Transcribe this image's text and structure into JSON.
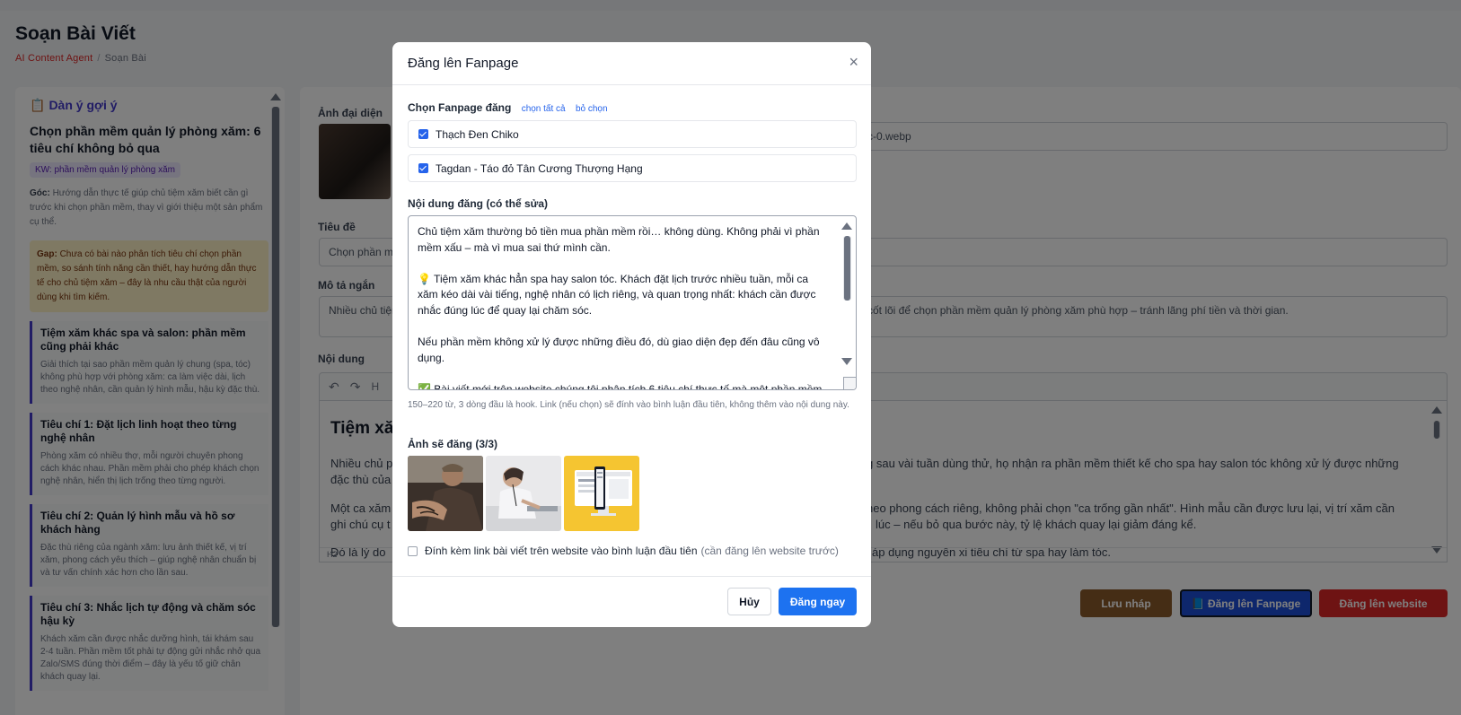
{
  "page": {
    "title": "Soạn Bài Viết",
    "breadcrumb": {
      "home": "AI Content Agent",
      "sep": "/",
      "current": "Soạn Bài"
    }
  },
  "outline": {
    "icon": "clipboard-icon",
    "heading": "Dàn ý gợi ý",
    "article_title": "Chọn phần mềm quản lý phòng xăm: 6 tiêu chí không bỏ qua",
    "keyword": "KW: phần mềm quản lý phòng xăm",
    "angle_label": "Góc:",
    "angle_text": "Hướng dẫn thực tế giúp chủ tiệm xăm biết cần gì trước khi chọn phần mềm, thay vì giới thiệu một sản phẩm cụ thể.",
    "gap_label": "Gap:",
    "gap_text": "Chưa có bài nào phân tích tiêu chí chọn phần mềm, so sánh tính năng cần thiết, hay hướng dẫn thực tế cho chủ tiệm xăm – đây là nhu cầu thật của người dùng khi tìm kiếm.",
    "sections": [
      {
        "title": "Tiệm xăm khác spa và salon: phần mềm cũng phải khác",
        "desc": "Giải thích tại sao phần mềm quản lý chung (spa, tóc) không phù hợp với phòng xăm: ca làm việc dài, lịch theo nghệ nhân, cần quản lý hình mẫu, hậu kỳ đặc thù."
      },
      {
        "title": "Tiêu chí 1: Đặt lịch linh hoạt theo từng nghệ nhân",
        "desc": "Phòng xăm có nhiều thợ, mỗi người chuyên phong cách khác nhau. Phần mềm phải cho phép khách chọn nghệ nhân, hiển thị lịch trống theo từng người."
      },
      {
        "title": "Tiêu chí 2: Quản lý hình mẫu và hồ sơ khách hàng",
        "desc": "Đặc thù riêng của ngành xăm: lưu ảnh thiết kế, vị trí xăm, phong cách yêu thích – giúp nghệ nhân chuẩn bị và tư vấn chính xác hơn cho lần sau."
      },
      {
        "title": "Tiêu chí 3: Nhắc lịch tự động và chăm sóc hậu kỳ",
        "desc": "Khách xăm cần được nhắc dưỡng hình, tái khám sau 2-4 tuần. Phần mềm tốt phải tự động gửi nhắc nhở qua Zalo/SMS đúng thời điểm – đây là yếu tố giữ chân khách quay lại."
      }
    ]
  },
  "form": {
    "avatar_label": "Ảnh đại diện",
    "avatar_file": "c-0.webp",
    "title_label": "Tiêu đề",
    "title_value": "Chọn phần m",
    "summary_label": "Mô tả ngắn",
    "summary_left": "Nhiều chủ tiệm",
    "summary_right": "cốt lõi để chọn phần mềm quản lý phòng xăm phù hợp – tránh lãng phí tiền và thời gian.",
    "content_label": "Nội dung",
    "toolbar_undo": "↶",
    "toolbar_redo": "↷",
    "toolbar_heading": "H",
    "editor_heading": "Tiệm xă",
    "editor_lines": [
      "Nhiều chủ p",
      "đặc thù của",
      "Một ca xăm",
      "ghi chú cụ t",
      "Đó là lý do"
    ],
    "editor_lines_right": [
      "g sau vài tuần dùng thử, họ nhận ra phần mềm thiết kế cho spa hay salon tóc không xử lý được những",
      "",
      "heo phong cách riêng, không phải chọn \"ca trống gần nhất\". Hình mẫu cần được lưu lại, vị trí xăm cần",
      "lúc – nếu bỏ qua bước này, tỷ lệ khách quay lại giảm đáng kể.",
      "áp dụng nguyên xi tiêu chí từ spa hay làm tóc."
    ],
    "editor_status": "H2",
    "buttons": {
      "draft": "Lưu nháp",
      "fanpage": "📘 Đăng lên Fanpage",
      "website": "Đăng lên website"
    }
  },
  "modal": {
    "title": "Đăng lên Fanpage",
    "close": "×",
    "choose_label": "Chọn Fanpage đăng",
    "select_all": "chọn tất cả",
    "deselect": "bỏ chọn",
    "pages": [
      {
        "name": "Thạch Đen Chiko",
        "checked": true
      },
      {
        "name": "Tagdan - Táo đỏ Tân Cương Thượng Hạng",
        "checked": true
      }
    ],
    "content_label": "Nội dung đăng (có thể sửa)",
    "content_paragraphs": [
      "Chủ tiệm xăm thường bỏ tiền mua phần mềm rồi… không dùng. Không phải vì phần mềm xấu – mà vì mua sai thứ mình cần.",
      "💡 Tiệm xăm khác hẳn spa hay salon tóc. Khách đặt lịch trước nhiều tuần, mỗi ca xăm kéo dài vài tiếng, nghệ nhân có lịch riêng, và quan trọng nhất: khách cần được nhắc đúng lúc để quay lại chăm sóc.",
      "Nếu phần mềm không xử lý được những điều đó, dù giao diện đẹp đến đâu cũng vô dụng.",
      "✅ Bài viết mới trên website chúng tôi phân tích 6 tiêu chí thực tế mà một phần mềm"
    ],
    "hint": "150–220 từ, 3 dòng đầu là hook. Link (nếu chọn) sẽ đính vào bình luận đầu tiên, không thêm vào nội dung này.",
    "photos_label": "Ảnh sẽ đăng (3/3)",
    "attach_label": "Đính kèm link bài viết trên website vào bình luận đầu tiên",
    "attach_note": "(cần đăng lên website trước)",
    "cancel": "Hủy",
    "submit": "Đăng ngay"
  },
  "colors": {
    "primary": "#1d72f0",
    "danger": "#dc2626",
    "draft": "#8b5a2b",
    "outline_accent": "#4338ca"
  }
}
